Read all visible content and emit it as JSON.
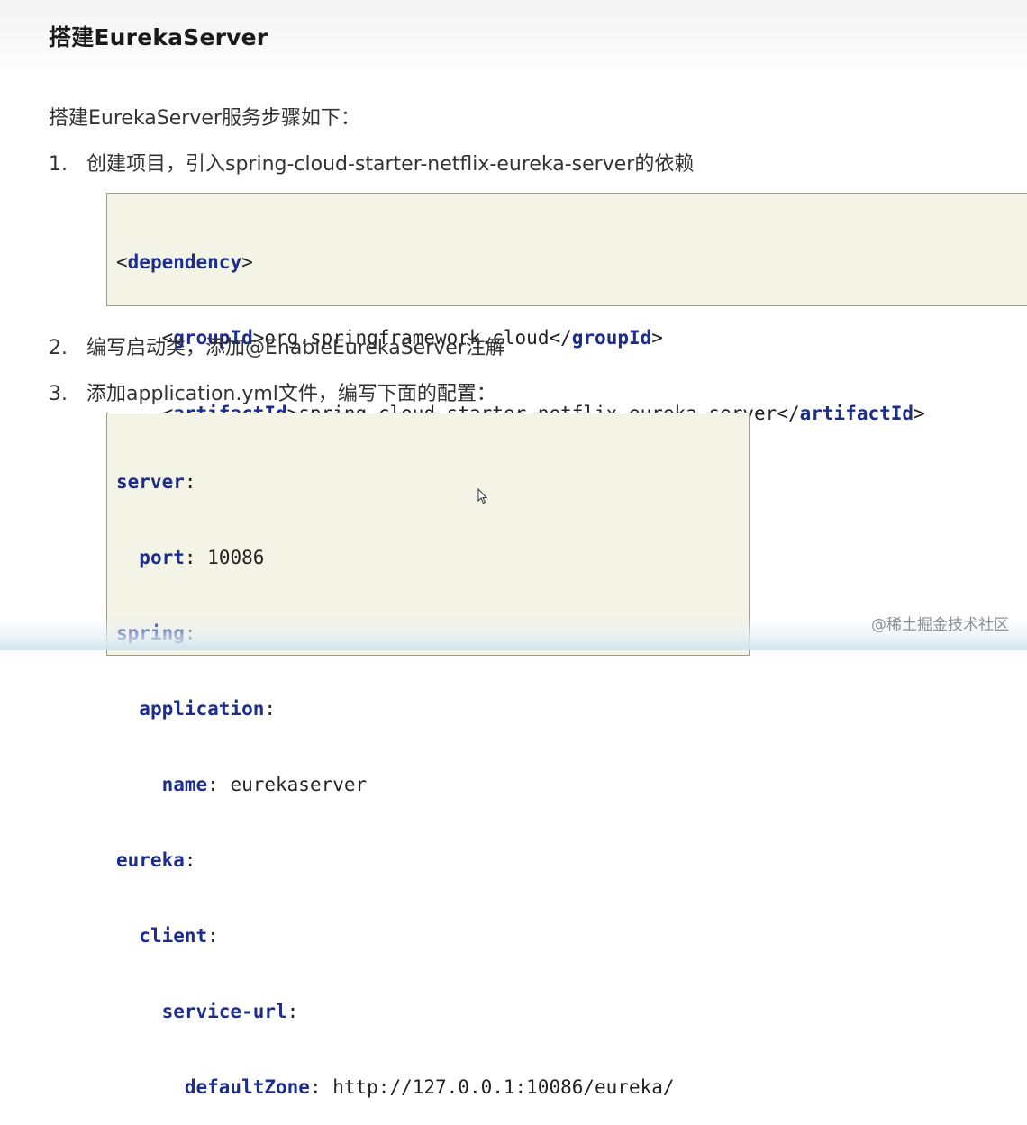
{
  "header": {
    "title": "搭建EurekaServer"
  },
  "intro": "搭建EurekaServer服务步骤如下：",
  "steps": [
    {
      "num": "1.",
      "text": "创建项目，引入spring-cloud-starter-netflix-eureka-server的依赖"
    },
    {
      "num": "2.",
      "text": "编写启动类，添加@EnableEurekaServer注解"
    },
    {
      "num": "3.",
      "text": "添加application.yml文件，编写下面的配置："
    }
  ],
  "xml_code": {
    "dependency_tag": "dependency",
    "groupId_tag": "groupId",
    "groupId_value": "org.springframework.cloud",
    "artifactId_tag": "artifactId",
    "artifactId_value": "spring-cloud-starter-netflix-eureka-server"
  },
  "yaml_code": {
    "server_key": "server",
    "port_key": "port",
    "port_value": "10086",
    "spring_key": "spring",
    "application_key": "application",
    "name_key": "name",
    "name_value": "eurekaserver",
    "eureka_key": "eureka",
    "client_key": "client",
    "service_url_key": "service-url",
    "default_zone_key": "defaultZone",
    "default_zone_value": "http://127.0.0.1:10086/eureka/"
  },
  "watermark": "@稀土掘金技术社区",
  "colors": {
    "code_bg": "#f3f3e6",
    "code_keyword": "#1c2d8c",
    "code_border": "#9b9b8c"
  }
}
